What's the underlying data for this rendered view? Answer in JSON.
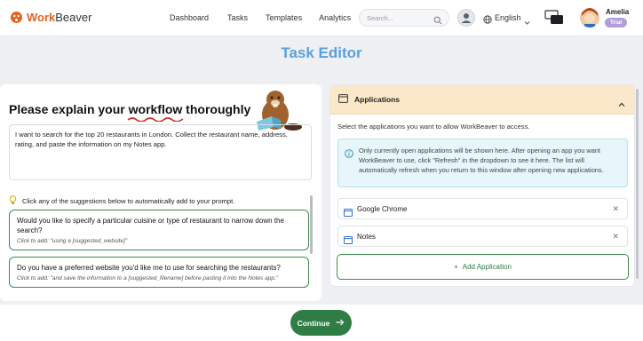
{
  "app": {
    "brand_prefix": "Work",
    "brand_suffix": "Beaver"
  },
  "nav": {
    "links": [
      "Dashboard",
      "Tasks",
      "Templates",
      "Analytics"
    ],
    "search_placeholder": "Search...",
    "language": "English",
    "user_name": "Amelia",
    "plan_badge": "Trial"
  },
  "page": {
    "title": "Task Editor"
  },
  "left": {
    "heading_1": "Please explain your ",
    "heading_2": "workflow",
    "heading_3": " thoroughly",
    "prompt_text": "I want to search for the top 20 restaurants in London. Collect the restaurant name, address, rating, and paste the information on my Notes app.",
    "hint": "Click any of the suggestions below to automatically add to your prompt.",
    "suggestions": [
      {
        "question": "Would you like to specify a particular cuisine or type of restaurant to narrow down the search?",
        "action": "Click to add: \"using a [suggested_website]\""
      },
      {
        "question": "Do you have a preferred website you'd like me to use for searching the restaurants?",
        "action": "Click to add: \"and save the information to a [suggested_filename] before pasting it into the Notes app.\""
      }
    ]
  },
  "right": {
    "header": "Applications",
    "description": "Select the applications you want to allow WorkBeaver to access.",
    "info": "Only currently open applications will be shown here. After opening an app you want WorkBeaver to use, click \"Refresh\" in the dropdown to see it here. The list will automatically refresh when you return to this window after opening new applications.",
    "apps": [
      "Google Chrome",
      "Notes"
    ],
    "add_label": "Add Application"
  },
  "footer": {
    "continue_label": "Continue"
  },
  "colors": {
    "brand": "#e4631f",
    "accent_green": "#2f7d44",
    "title_blue": "#5aa0dc",
    "header_tan": "#fbe8c8",
    "info_bg": "#e6f6fb"
  }
}
